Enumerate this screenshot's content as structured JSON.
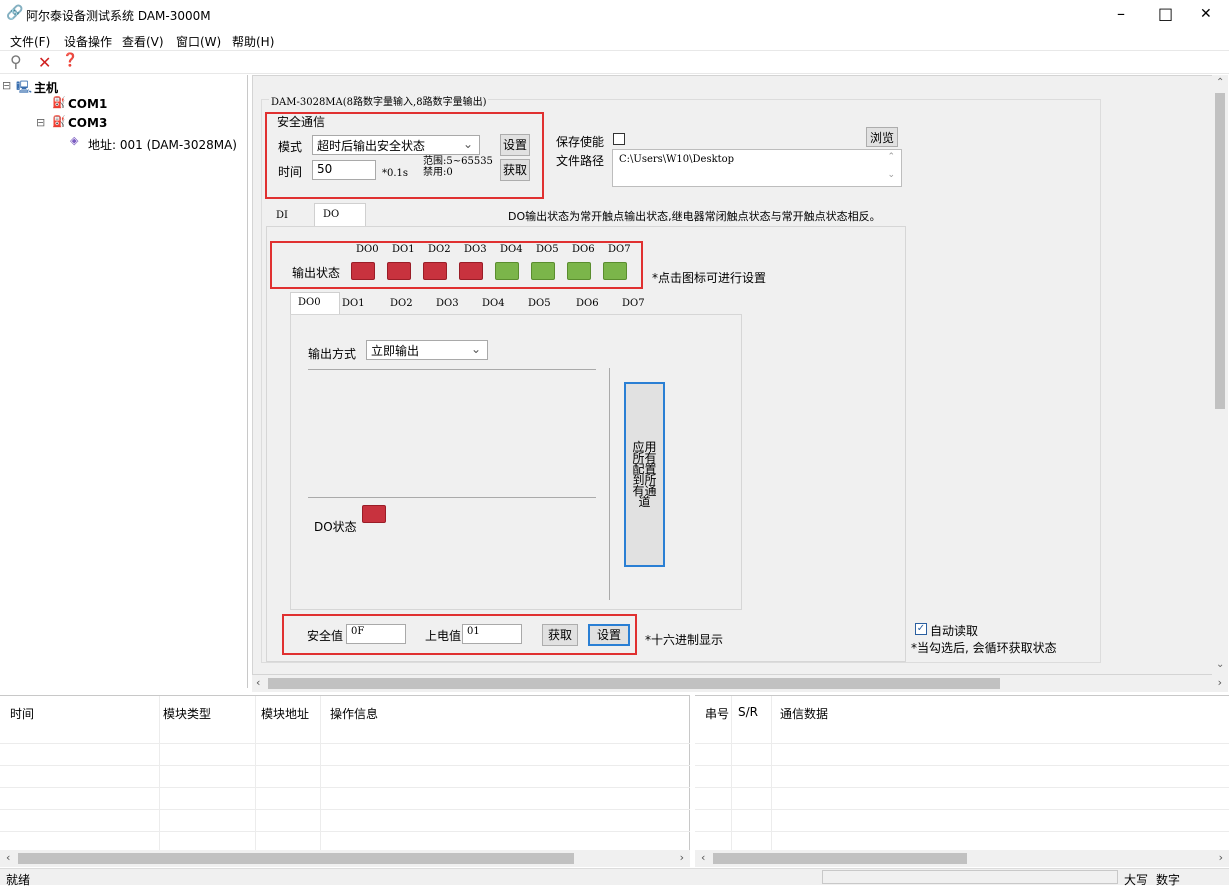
{
  "window": {
    "title": "阿尔泰设备测试系统 DAM-3000M",
    "min": "–",
    "max": "□",
    "close": "✕"
  },
  "menu": [
    "文件(F)",
    "设备操作",
    "查看(V)",
    "窗口(W)",
    "帮助(H)"
  ],
  "toolbar": {
    "search_glyph": "⚲",
    "delete_glyph": "✕",
    "help_glyph": "❓"
  },
  "tree": {
    "root": "主机",
    "root_toggle": "⊟",
    "com1": "COM1",
    "com3": "COM3",
    "com3_toggle": "⊟",
    "address": "地址: 001 (DAM-3028MA)"
  },
  "device": {
    "title": "DAM-3028MA(8路数字量输入,8路数字量输出)",
    "safety": {
      "title": "安全通信",
      "mode_label": "模式",
      "mode_value": "超时后输出安全状态",
      "set": "设置",
      "time_label": "时间",
      "time_value": "50",
      "time_unit": "*0.1s",
      "range_line1": "范围:5~65535",
      "range_line2": "禁用:0",
      "get": "获取"
    },
    "save": {
      "enable_label": "保存使能",
      "path_label": "文件路径",
      "path_value": "C:\\Users\\W10\\Desktop",
      "browse": "浏览"
    },
    "tabs": [
      "DI",
      "DO"
    ],
    "do_note": "DO输出状态为常开触点输出状态,继电器常闭触点状态与常开触点状态相反。",
    "outputs": {
      "label": "输出状态",
      "names": [
        "DO0",
        "DO1",
        "DO2",
        "DO3",
        "DO4",
        "DO5",
        "DO6",
        "DO7"
      ],
      "states": [
        "red",
        "red",
        "red",
        "red",
        "green",
        "green",
        "green",
        "green"
      ],
      "hint": "*点击图标可进行设置"
    },
    "channel_tabs": [
      "DO0",
      "DO1",
      "DO2",
      "DO3",
      "DO4",
      "DO5",
      "DO6",
      "DO7"
    ],
    "channel": {
      "mode_label": "输出方式",
      "mode_value": "立即输出",
      "apply_all": "应用所有配置到所有通道",
      "status_label": "DO状态"
    },
    "bottom": {
      "safe_label": "安全值",
      "safe_value": "0F",
      "power_label": "上电值",
      "power_value": "01",
      "get": "获取",
      "set": "设置",
      "hex_note": "*十六进制显示"
    },
    "auto_read": {
      "label": "自动读取",
      "note": "*当勾选后, 会循环获取状态"
    }
  },
  "log_table": {
    "headers": [
      "时间",
      "模块类型",
      "模块地址",
      "操作信息"
    ]
  },
  "comm_table": {
    "headers": [
      "串号",
      "S/R",
      "通信数据"
    ]
  },
  "statusbar": {
    "text": "就绪",
    "caps": "大写",
    "num": "数字"
  },
  "colors": {
    "led_on": "#c8323e",
    "led_off": "#7bb54a",
    "highlight": "#e03030",
    "apply_border": "#2a7fd4"
  }
}
